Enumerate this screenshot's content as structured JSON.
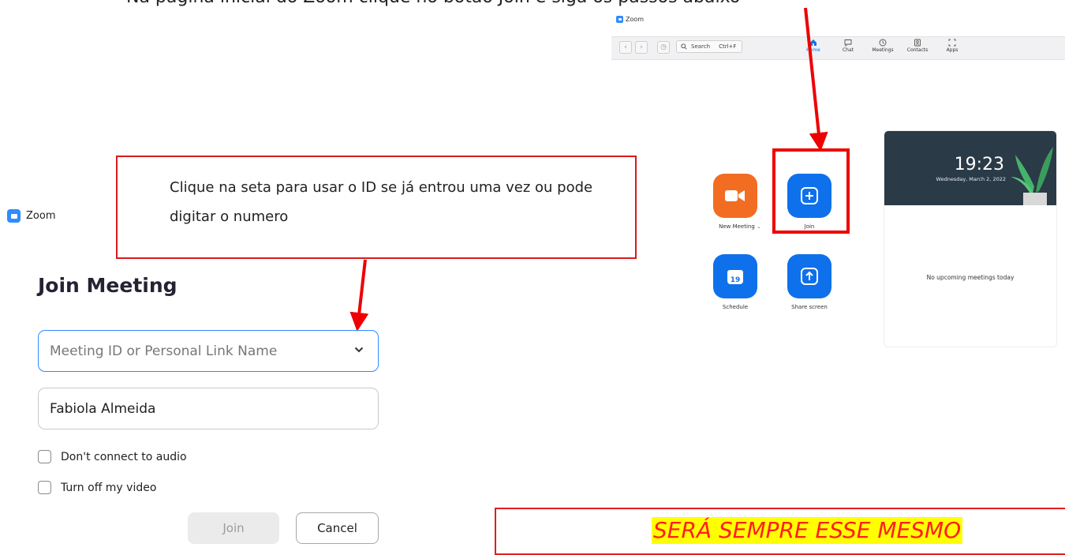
{
  "top_text": "Na página inicial do Zoom clique no botão Join e siga os passos abaixo",
  "zoom_home": {
    "app_title": "Zoom",
    "search": {
      "label": "Search",
      "shortcut": "Ctrl+F"
    },
    "tabs": [
      {
        "label": "Home",
        "icon": "home-icon",
        "active": true
      },
      {
        "label": "Chat",
        "icon": "chat-icon"
      },
      {
        "label": "Meetings",
        "icon": "clock-icon"
      },
      {
        "label": "Contacts",
        "icon": "contacts-icon"
      },
      {
        "label": "Apps",
        "icon": "apps-icon"
      }
    ],
    "tiles": [
      {
        "label": "New Meeting",
        "icon": "video-camera-icon",
        "color": "#F26D21"
      },
      {
        "label": "Join",
        "icon": "plus-icon",
        "color": "#0E71EB"
      },
      {
        "label": "Schedule",
        "icon": "calendar-icon",
        "color": "#0E71EB",
        "day": "19"
      },
      {
        "label": "Share screen",
        "icon": "share-up-arrow-icon",
        "color": "#0E71EB"
      }
    ],
    "calendar": {
      "time": "19:23",
      "date": "Wednesday, March 2, 2022",
      "empty_text": "No upcoming meetings today"
    }
  },
  "callout": {
    "text": "Clique na seta para usar o ID se já entrou uma vez ou pode digitar o numero"
  },
  "join_window": {
    "app_title": "Zoom",
    "heading": "Join Meeting",
    "meeting_id_placeholder": "Meeting ID or Personal Link Name",
    "name_value": "Fabiola Almeida",
    "options": [
      {
        "label": "Don't connect to audio",
        "checked": false
      },
      {
        "label": "Turn off my video",
        "checked": false
      }
    ],
    "join_label": "Join",
    "cancel_label": "Cancel"
  },
  "bottom_note": {
    "text": "SERÁ SEMPRE ESSE MESMO"
  },
  "colors": {
    "annotation_red": "#EE0000",
    "zoom_blue": "#2D8CFF",
    "highlight_yellow": "#FFFF00"
  }
}
